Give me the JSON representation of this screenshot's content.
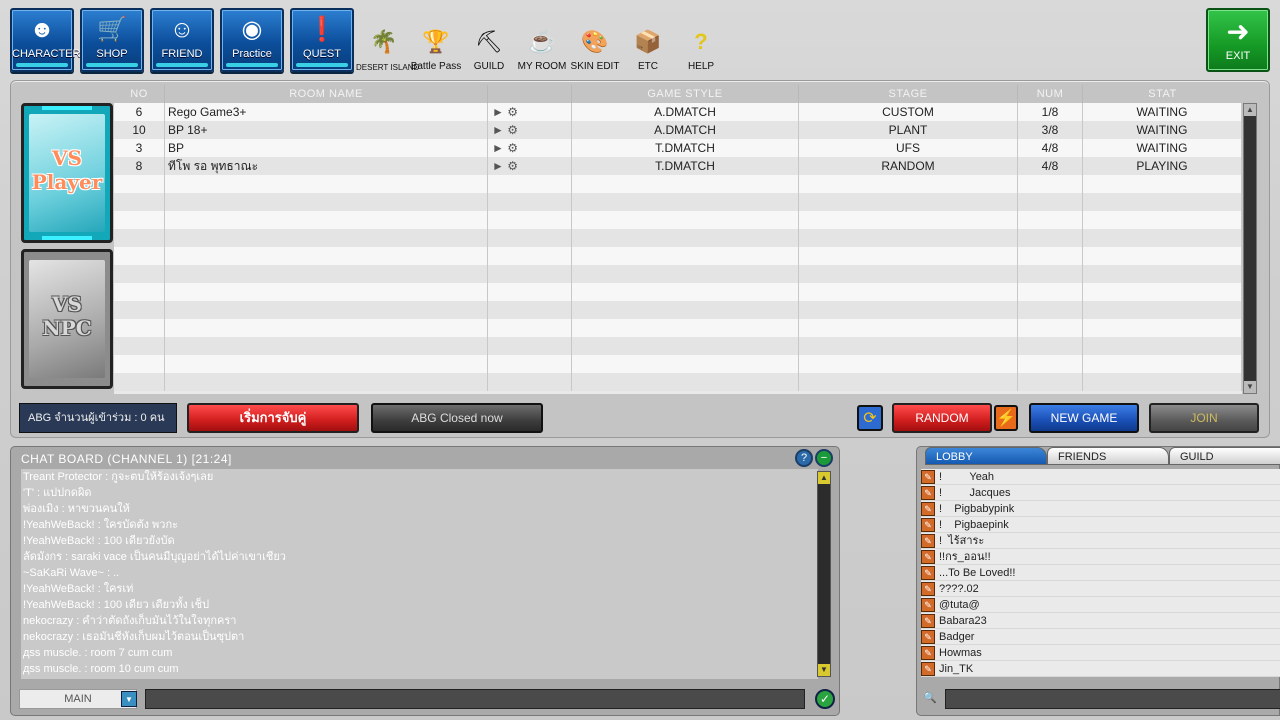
{
  "nav": {
    "main": [
      {
        "label": "CHARACTER",
        "icon": "character-icon"
      },
      {
        "label": "SHOP",
        "icon": "cart-icon"
      },
      {
        "label": "FRIEND",
        "icon": "friend-icon"
      },
      {
        "label": "Practice",
        "icon": "practice-icon"
      },
      {
        "label": "QUEST",
        "icon": "quest-icon"
      }
    ],
    "mini": [
      {
        "label": "DESERT ISLAND",
        "icon": "palm-tree-icon"
      },
      {
        "label": "Battle Pass",
        "icon": "trophy-icon"
      },
      {
        "label": "GUILD",
        "icon": "guild-icon"
      },
      {
        "label": "MY ROOM",
        "icon": "room-icon"
      },
      {
        "label": "SKIN EDIT",
        "icon": "spray-can-icon"
      },
      {
        "label": "ETC",
        "icon": "box-icon"
      },
      {
        "label": "HELP",
        "icon": "question-icon"
      }
    ],
    "exit": "EXIT"
  },
  "modes": {
    "player": "VS\nPlayer",
    "npc": "VS\nNPC"
  },
  "room_table": {
    "headers": [
      "NO",
      "ROOM NAME",
      "",
      "GAME STYLE",
      "STAGE",
      "NUM",
      "STAT"
    ],
    "rows": [
      {
        "no": "6",
        "name": "Rego Game3+",
        "style": "A.DMATCH",
        "stage": "CUSTOM",
        "num": "1/8",
        "stat": "WAITING"
      },
      {
        "no": "10",
        "name": "BP 18+",
        "style": "A.DMATCH",
        "stage": "PLANT",
        "num": "3/8",
        "stat": "WAITING"
      },
      {
        "no": "3",
        "name": "BP",
        "style": "T.DMATCH",
        "stage": "UFS",
        "num": "4/8",
        "stat": "WAITING"
      },
      {
        "no": "8",
        "name": "ทีโพ รอ พุทธาณะ",
        "style": "T.DMATCH",
        "stage": "RANDOM",
        "num": "4/8",
        "stat": "PLAYING"
      }
    ],
    "empty_rows": 12
  },
  "controls": {
    "user_count": "ABG จำนวนผู้เข้าร่วม : 0 คน",
    "match_button": "เริ่มการจับคู่",
    "close_button": "ABG Closed now",
    "random_button": "RANDOM",
    "new_game_button": "NEW GAME",
    "join_button": "JOIN"
  },
  "chat": {
    "title": "CHAT BOARD (CHANNEL 1) [21:24]",
    "lines": [
      "Treant Protector : กูจะตบให้ร้องเจ้งๆเลย",
      "'T' : แปปกดผิด",
      "พ่องเมิง : หาขวนคนให้",
      "!YeahWeBack! : ใครบัดตัง พวกะ",
      "!YeahWeBack! : 100 เดียวยังบัด",
      "ลัดมังกร : saraki vace เป็นคนมีบุญอย่าได้ไปค่าเขาเชียว",
      "~SaKaRi Wave~ : ..",
      "!YeahWeBack! : ใครเท่",
      "!YeahWeBack! : 100 เดียว เดียวทั้ง เช็ป",
      "nekocrazy : คำว่าตัดถังเก็บมันไว้ในใจทุกครา",
      "nekocrazy : เธอมันชีหังเก็บผมไว้ตอนเป็นซุปตา",
      "дss muscle. : room 7 cum cum",
      "дss muscle. : room 10 cum cum"
    ],
    "channel": "MAIN"
  },
  "lobby": {
    "tabs": [
      "LOBBY",
      "FRIENDS",
      "GUILD"
    ],
    "users": [
      "!         Yeah",
      "!         Jacques",
      "!    Pigbabypink",
      "!    Pigbaepink",
      "!  ไร้สาระ",
      "!!กร_ออน!!",
      "...To Be Loved!!",
      "????.02",
      "@tuta@",
      "Babara23",
      "Badger",
      "Howmas",
      "Jin_TK"
    ]
  },
  "colors": {
    "nav_blue": "#0c4e9b",
    "exit_green": "#159a26",
    "red_button": "#d01d1d",
    "blue_button": "#1a4fb5",
    "active_tab": "#155ab0"
  }
}
